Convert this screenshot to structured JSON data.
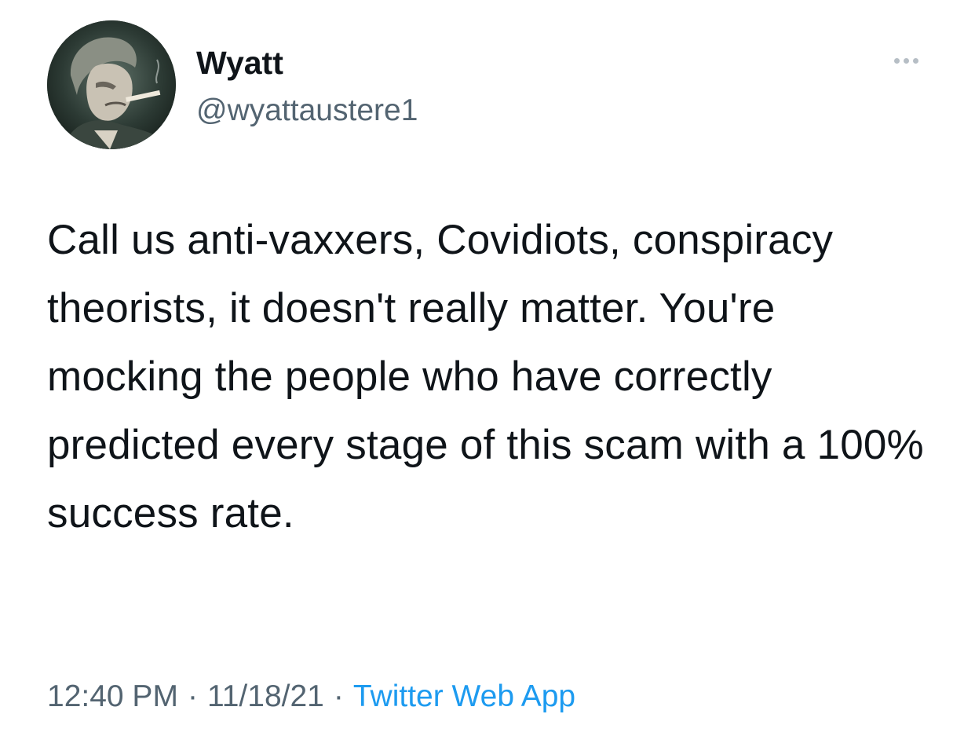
{
  "tweet": {
    "author": {
      "display_name": "Wyatt",
      "handle": "@wyattaustere1",
      "avatar_icon": "profile-photo-man-smoking"
    },
    "more_icon": "ellipsis-icon",
    "text": "Call us anti-vaxxers, Covidiots, conspiracy theorists, it doesn't really matter. You're mocking the people who have correctly predicted every stage of this scam with a 100% success rate.",
    "timestamp_time": "12:40 PM",
    "separator": "·",
    "timestamp_date": "11/18/21",
    "source": "Twitter Web App"
  },
  "colors": {
    "text_primary": "#0f1419",
    "text_secondary": "#536471",
    "link": "#1d9bf0",
    "more_dots": "#b6bec5"
  }
}
